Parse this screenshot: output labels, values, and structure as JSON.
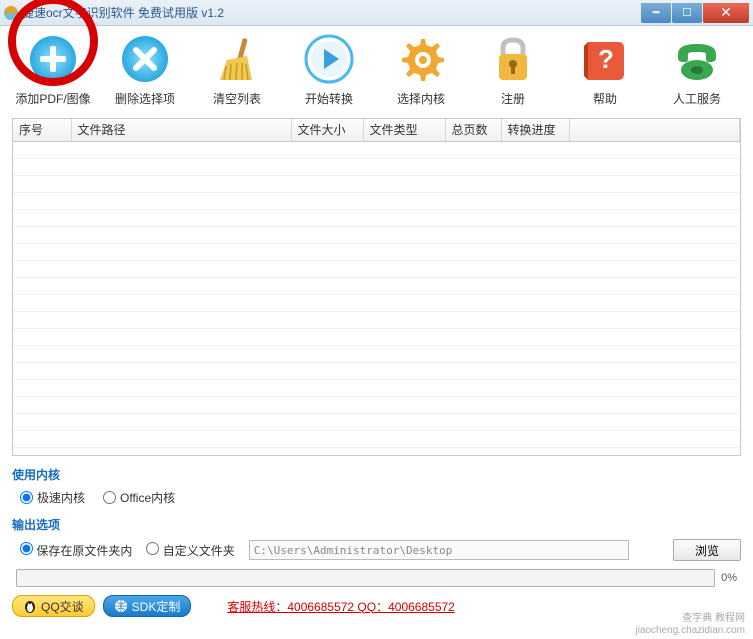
{
  "title": "捷速ocr文字识别软件 免费试用版 v1.2",
  "toolbar": {
    "add": "添加PDF/图像",
    "delete": "删除选择项",
    "clear": "清空列表",
    "start": "开始转换",
    "kernel": "选择内核",
    "register": "注册",
    "help": "帮助",
    "service": "人工服务"
  },
  "table": {
    "headers": {
      "num": "序号",
      "path": "文件路径",
      "size": "文件大小",
      "type": "文件类型",
      "pages": "总页数",
      "progress": "转换进度"
    },
    "rows": []
  },
  "kernel_section": {
    "label": "使用内核",
    "options": {
      "fast": "极速内核",
      "office": "Office内核"
    },
    "selected": "fast"
  },
  "output_section": {
    "label": "输出选项",
    "options": {
      "original": "保存在原文件夹内",
      "custom": "自定义文件夹"
    },
    "selected": "original",
    "path": "C:\\Users\\Administrator\\Desktop",
    "browse": "浏览"
  },
  "progress": {
    "percent": "0%"
  },
  "bottom": {
    "qq": "QQ交谈",
    "sdk": "SDK定制",
    "hotline": "客服热线：4006685572 QQ：4006685572"
  },
  "watermark": {
    "line1": "查字典 教程网",
    "line2": "jiaocheng.chazidian.com"
  }
}
